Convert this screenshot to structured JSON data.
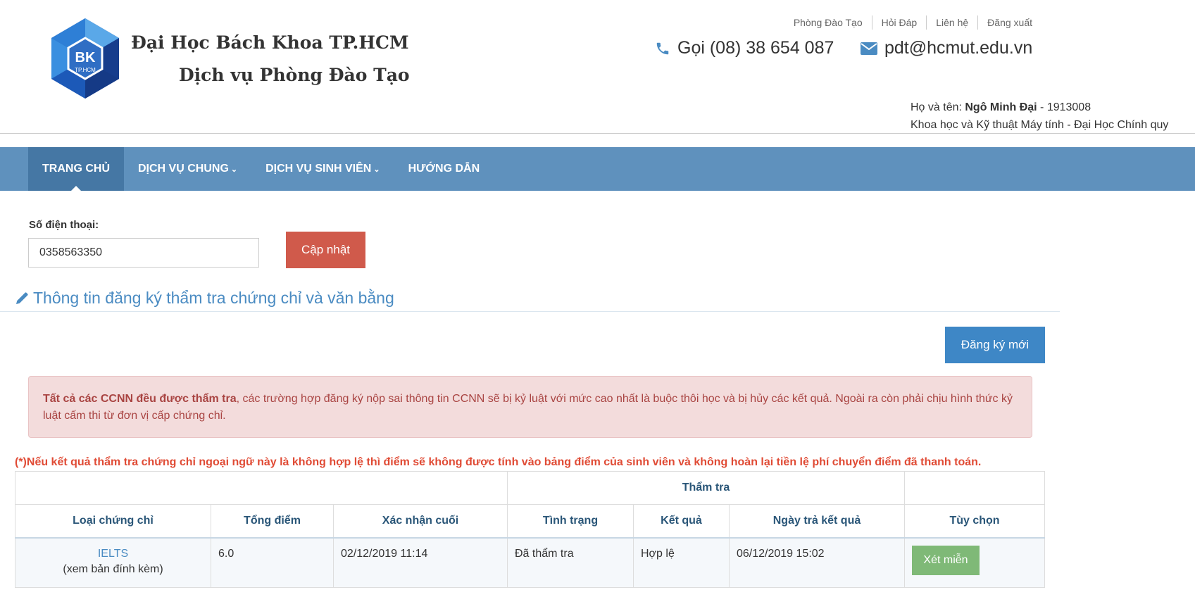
{
  "header": {
    "logo_text": "BK",
    "logo_subtext": "TP.HCM",
    "brand_line1": "Đại Học Bách Khoa TP.HCM",
    "brand_line2": "Dịch vụ Phòng Đào Tạo",
    "top_links": [
      "Phòng Đào Tạo",
      "Hỏi Đáp",
      "Liên hệ",
      "Đăng xuất"
    ],
    "phone": "Gọi (08) 38 654 087",
    "email": "pdt@hcmut.edu.vn",
    "user": {
      "name_label": "Họ và tên: ",
      "name": "Ngô Minh Đại",
      "id_suffix": " - 1913008",
      "program": "Khoa học và Kỹ thuật Máy tính - Đại Học Chính quy"
    }
  },
  "nav": {
    "items": [
      "TRANG CHỦ",
      "DỊCH VỤ CHUNG",
      "DỊCH VỤ SINH VIÊN",
      "HƯỚNG DẪN"
    ]
  },
  "phone_form": {
    "label": "Số điện thoại:",
    "value": "0358563350",
    "update_button": "Cập nhật"
  },
  "section": {
    "title": "Thông tin đăng ký thẩm tra chứng chỉ và văn bằng",
    "register_button": "Đăng ký mới"
  },
  "alert": {
    "bold": "Tất cả các CCNN đều được thẩm tra",
    "text": ", các trường hợp đăng ký nộp sai thông tin CCNN sẽ bị kỷ luật với mức cao nhất là buộc thôi học và bị hủy các kết quả. Ngoài ra còn phải chịu hình thức kỷ luật cấm thi từ đơn vị cấp chứng chỉ."
  },
  "note": "(*)Nếu kết quả thẩm tra chứng chỉ ngoại ngữ này là không hợp lệ thì điểm sẽ không được tính vào bảng điểm của sinh viên và không hoàn lại tiền lệ phí chuyển điểm đã thanh toán.",
  "table": {
    "group_header": "Thẩm tra",
    "columns": [
      "Loại chứng chỉ",
      "Tổng điểm",
      "Xác nhận cuối",
      "Tình trạng",
      "Kết quả",
      "Ngày trả kết quả",
      "Tùy chọn"
    ],
    "rows": [
      {
        "type": "IELTS",
        "attachment": "(xem bản đính kèm)",
        "score": "6.0",
        "last_confirm": "02/12/2019 11:14",
        "status": "Đã thẩm tra",
        "result": "Hợp lệ",
        "return_date": "06/12/2019 15:02",
        "action": "Xét miễn"
      }
    ]
  },
  "colors": {
    "nav_bg": "#5f91bd",
    "nav_active": "#4577a4",
    "update_button": "#d05a4b",
    "register_button": "#3e87c6",
    "exempt_button": "#7fb977",
    "note_text": "#e04b35"
  }
}
